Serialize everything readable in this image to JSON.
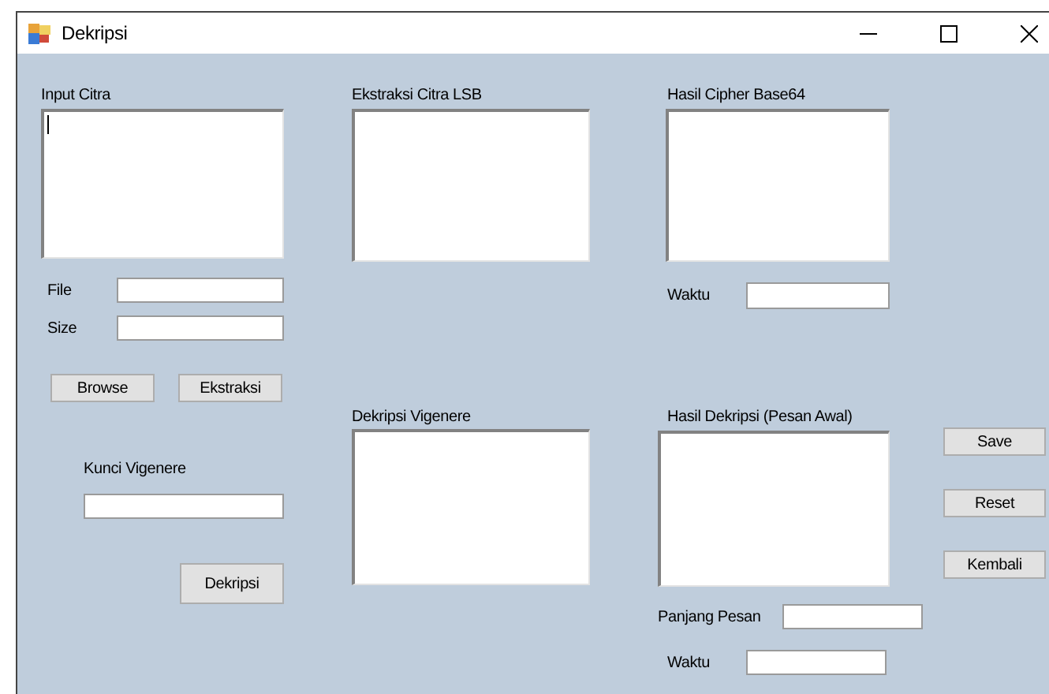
{
  "window": {
    "title": "Dekripsi"
  },
  "input_citra": {
    "label": "Input Citra",
    "focused": true
  },
  "file_field": {
    "label": "File"
  },
  "size_field": {
    "label": "Size"
  },
  "left_buttons": [
    "Browse",
    "Ekstraksi"
  ],
  "kunci_vigenere": {
    "label": "Kunci Vigenere"
  },
  "dekripsi_button": "Dekripsi",
  "ekstraksi_citra_lsb": {
    "label": "Ekstraksi Citra LSB"
  },
  "dekripsi_vigenere": {
    "label": "Dekripsi Vigenere"
  },
  "hasil_cipher_base64": {
    "label": "Hasil Cipher Base64"
  },
  "cipher_time": {
    "label": "Waktu"
  },
  "hasil_dekripsi": {
    "label": "Hasil Dekripsi (Pesan Awal)"
  },
  "panjang_pesan": {
    "label": "Panjang Pesan"
  },
  "dekripsi_time": {
    "label": "Waktu"
  },
  "side_buttons": [
    "Save",
    "Reset",
    "Kembali"
  ]
}
